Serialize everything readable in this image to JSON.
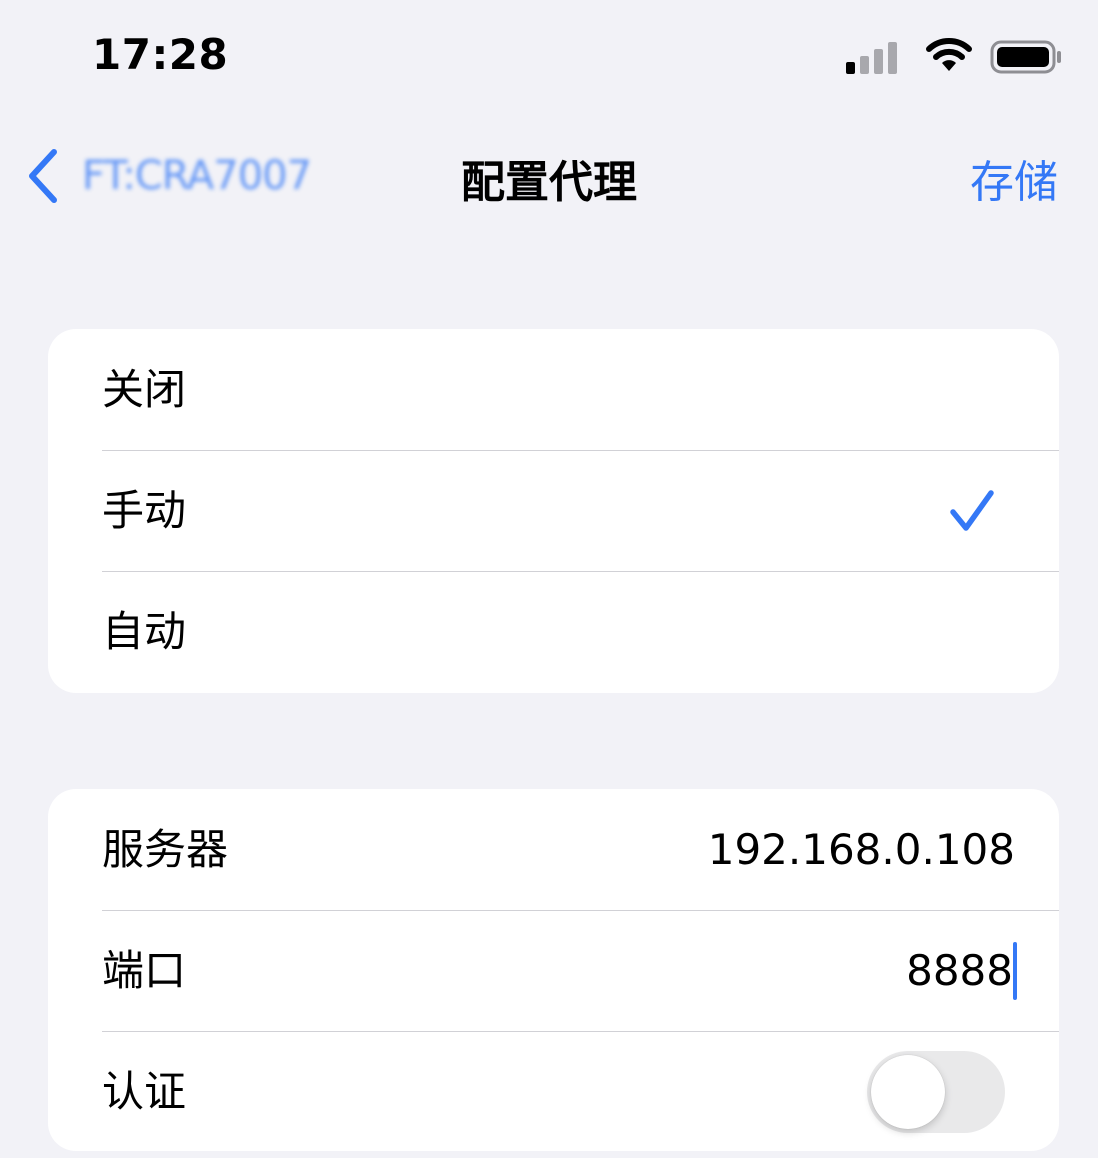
{
  "status_bar": {
    "time": "17:28",
    "signal_icon": "cellular-signal-icon",
    "wifi_icon": "wifi-icon",
    "battery_icon": "battery-icon"
  },
  "nav": {
    "back_label": "FT:CRA7007",
    "title": "配置代理",
    "save_label": "存储"
  },
  "mode_group": {
    "options": [
      {
        "label": "关闭",
        "selected": false
      },
      {
        "label": "手动",
        "selected": true
      },
      {
        "label": "自动",
        "selected": false
      }
    ]
  },
  "detail_group": {
    "server_label": "服务器",
    "server_value": "192.168.0.108",
    "port_label": "端口",
    "port_value": "8888",
    "auth_label": "认证",
    "auth_enabled": false
  },
  "colors": {
    "accent": "#3478f6",
    "background": "#f2f2f7",
    "card": "#ffffff",
    "separator": "#d1d1d6",
    "toggle_off": "#e9e9ea"
  }
}
